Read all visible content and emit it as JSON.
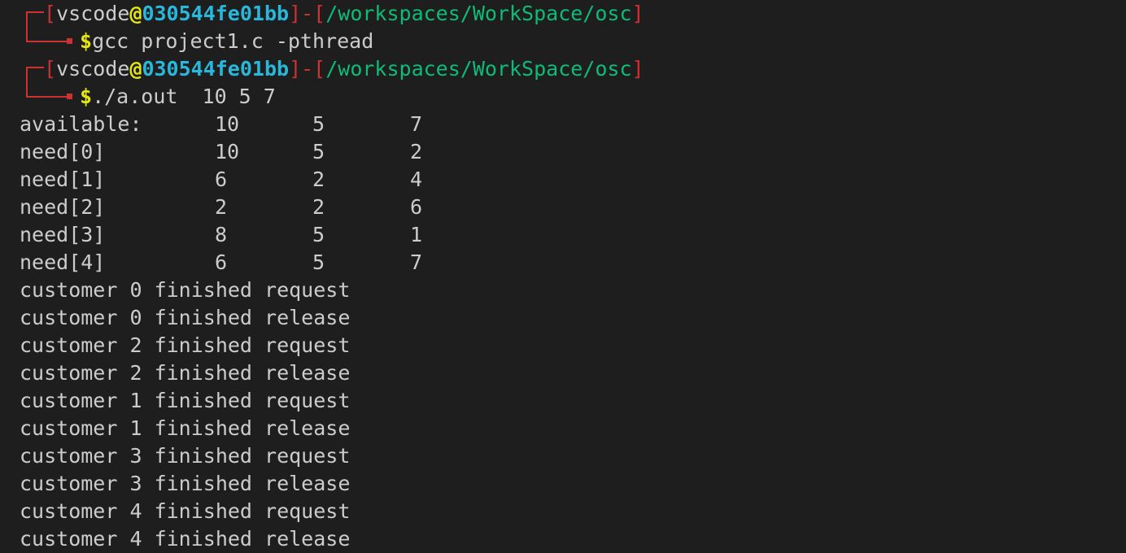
{
  "prompts": [
    {
      "user": "vscode",
      "at": "@",
      "host": "030544fe01bb",
      "separator": "]-[",
      "open": "[",
      "path": "/workspaces/WorkSpace/osc",
      "close": "]",
      "dollar": "$",
      "command": "gcc project1.c -pthread"
    },
    {
      "user": "vscode",
      "at": "@",
      "host": "030544fe01bb",
      "separator": "]-[",
      "open": "[",
      "path": "/workspaces/WorkSpace/osc",
      "close": "]",
      "dollar": "$",
      "command": "./a.out  10 5 7"
    }
  ],
  "table": [
    {
      "label": "available:",
      "v1": "10",
      "v2": "5",
      "v3": "7"
    },
    {
      "label": "need[0]",
      "v1": "10",
      "v2": "5",
      "v3": "2"
    },
    {
      "label": "need[1]",
      "v1": "6",
      "v2": "2",
      "v3": "4"
    },
    {
      "label": "need[2]",
      "v1": "2",
      "v2": "2",
      "v3": "6"
    },
    {
      "label": "need[3]",
      "v1": "8",
      "v2": "5",
      "v3": "1"
    },
    {
      "label": "need[4]",
      "v1": "6",
      "v2": "5",
      "v3": "7"
    }
  ],
  "log": [
    "customer 0 finished request",
    "customer 0 finished release",
    "customer 2 finished request",
    "customer 2 finished release",
    "customer 1 finished request",
    "customer 1 finished release",
    "customer 3 finished request",
    "customer 3 finished release",
    "customer 4 finished request",
    "customer 4 finished release"
  ],
  "colors": {
    "background": "#1e1e1e",
    "bracket_red": "#cd3131",
    "host_cyan": "#29b8db",
    "path_green": "#0dbc79",
    "accent_yellow": "#e5e510",
    "text": "#cccccc"
  }
}
